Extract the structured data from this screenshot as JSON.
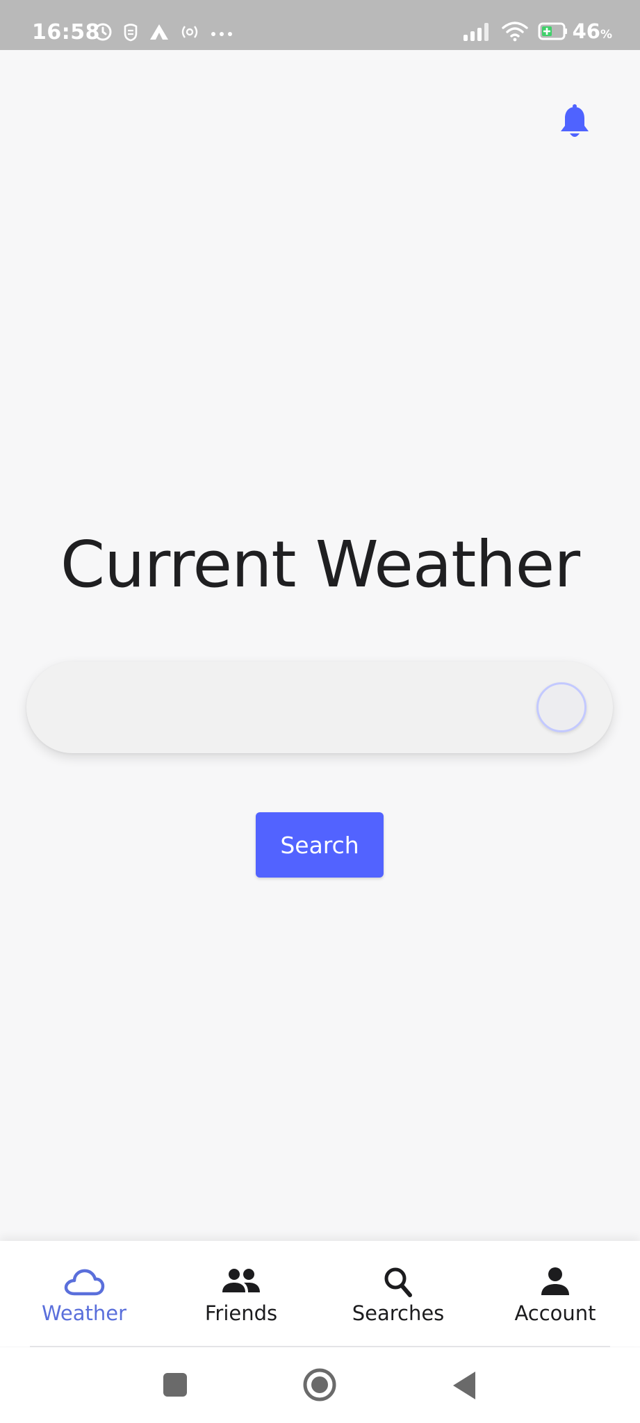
{
  "status_bar": {
    "time": "16:58",
    "battery_percent": "46",
    "battery_unit": "%",
    "icons": [
      "alarm-icon",
      "shield-icon",
      "triangle-app-icon",
      "hotspot-icon",
      "more-dots-icon",
      "signal-icon",
      "wifi-icon",
      "battery-charging-icon"
    ]
  },
  "header": {
    "notification_icon": "bell-icon",
    "accent_color": "#4f63ff"
  },
  "main": {
    "title": "Current Weather",
    "search": {
      "value": "",
      "placeholder": ""
    },
    "search_button_label": "Search"
  },
  "bottom_nav": {
    "active_index": 0,
    "active_color": "#5a6fdb",
    "items": [
      {
        "label": "Weather",
        "icon": "cloud-icon"
      },
      {
        "label": "Friends",
        "icon": "people-icon"
      },
      {
        "label": "Searches",
        "icon": "search-icon"
      },
      {
        "label": "Account",
        "icon": "person-icon"
      }
    ]
  },
  "system_nav": {
    "buttons": [
      "recents-button",
      "home-button",
      "back-button"
    ]
  }
}
